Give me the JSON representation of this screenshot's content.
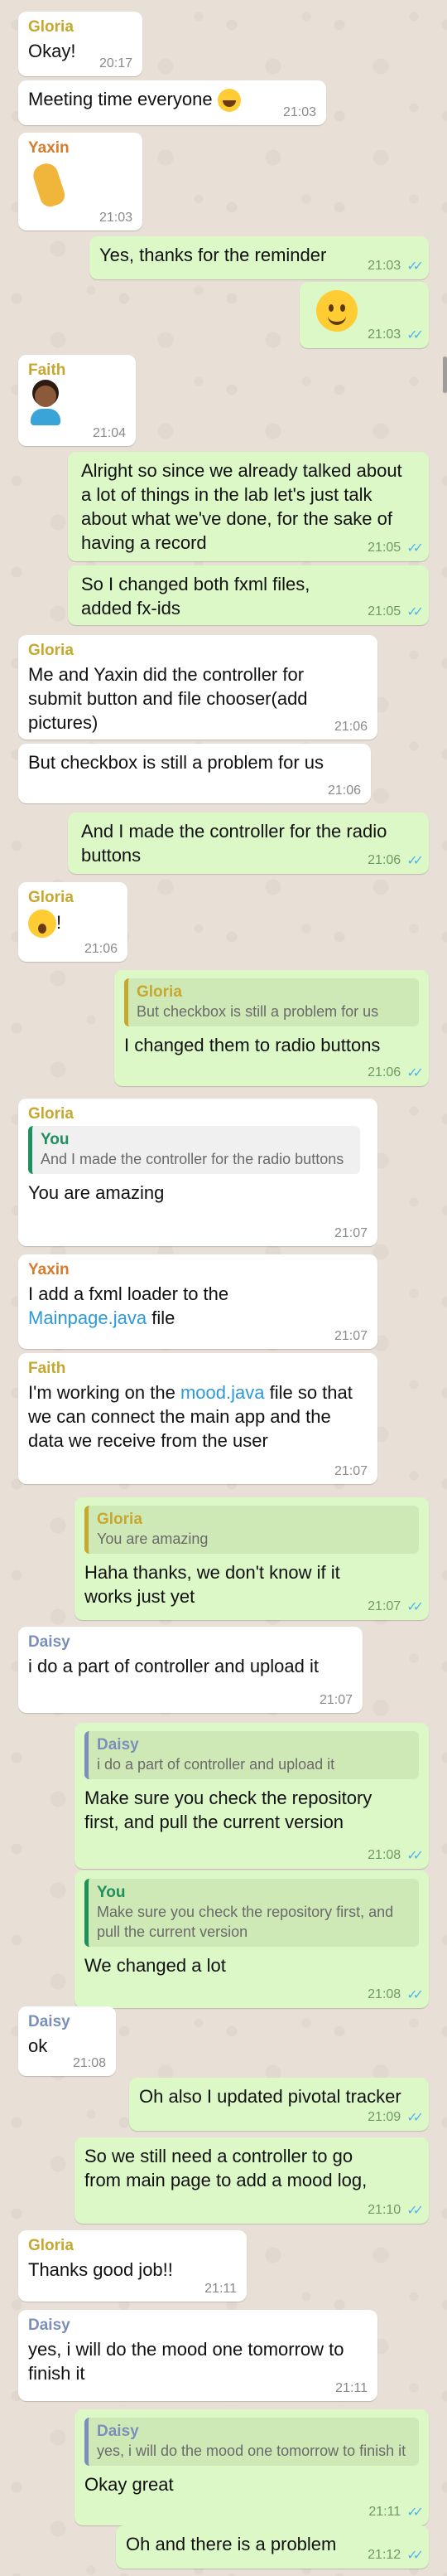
{
  "colors": {
    "gloria": "#c6a830",
    "yaxin": "#d77b2c",
    "faith": "#c6a830",
    "daisy": "#7b8fbb",
    "you": "#1f8f5b",
    "outgoing_bg": "#dcf8c6",
    "incoming_bg": "#ffffff",
    "read_ticks": "#4fb6ec"
  },
  "messages": [
    {
      "sender": "Gloria",
      "text": "Okay!",
      "time": "20:17"
    },
    {
      "text": "Meeting time everyone",
      "emoji": "face-with-tears-of-joy",
      "time": "21:03"
    },
    {
      "sender": "Yaxin",
      "emoji": "ok-hand",
      "time": "21:03"
    },
    {
      "text": "Yes, thanks for the reminder",
      "time": "21:03"
    },
    {
      "emoji": "smiling-face",
      "time": "21:03"
    },
    {
      "sender": "Faith",
      "emoji": "person-raising-hand",
      "time": "21:04"
    },
    {
      "text": "Alright so since we already talked about a lot of things in the lab let's just talk about what we've done, for the sake of having a record",
      "time": "21:05"
    },
    {
      "text": "So I changed both fxml files, added fx-ids",
      "time": "21:05"
    },
    {
      "sender": "Gloria",
      "text": "Me and Yaxin did the controller for submit button and file chooser(add pictures)",
      "time": "21:06"
    },
    {
      "text": "But checkbox is still a problem for us",
      "time": "21:06"
    },
    {
      "text": "And I made the controller for the radio buttons",
      "time": "21:06"
    },
    {
      "sender": "Gloria",
      "text": "!",
      "emoji": "astonished-face",
      "time": "21:06"
    },
    {
      "quote_name": "Gloria",
      "quote_text": "But checkbox is still a problem for us",
      "text": "I changed them to radio buttons",
      "time": "21:06"
    },
    {
      "sender": "Gloria",
      "quote_name": "You",
      "quote_text": "And I made the controller for the radio buttons",
      "text": "You are amazing",
      "time": "21:07"
    },
    {
      "sender": "Yaxin",
      "text": "I add a fxml loader to the",
      "link": "Mainpage.java",
      "text_after": " file",
      "time": "21:07"
    },
    {
      "sender": "Faith",
      "text": "I'm working on the ",
      "link": "mood.java",
      "text_after": " file so that we can connect the main app and the data we receive from the user",
      "time": "21:07"
    },
    {
      "quote_name": "Gloria",
      "quote_text": "You are amazing",
      "text": "Haha thanks, we don't know if it works just yet",
      "time": "21:07"
    },
    {
      "sender": "Daisy",
      "text": "i do a part of controller and upload it",
      "time": "21:07"
    },
    {
      "quote_name": "Daisy",
      "quote_text": "i do a part of controller and upload it",
      "text": "Make sure you check the repository first, and pull the current version",
      "time": "21:08"
    },
    {
      "quote_name": "You",
      "quote_text": "Make sure you check the repository first, and pull the current version",
      "text": "We changed a lot",
      "time": "21:08"
    },
    {
      "sender": "Daisy",
      "text": "ok",
      "time": "21:08"
    },
    {
      "text": "Oh also I updated pivotal tracker",
      "time": "21:09"
    },
    {
      "text": "So we still need a controller to go from main page to add a mood log,",
      "time": "21:10"
    },
    {
      "sender": "Gloria",
      "text": "Thanks good job!!",
      "time": "21:11"
    },
    {
      "sender": "Daisy",
      "text": "yes, i will do the mood one tomorrow to finish it",
      "time": "21:11"
    },
    {
      "quote_name": "Daisy",
      "quote_text": "yes, i will do the mood one tomorrow to finish it",
      "text": "Okay great",
      "time": "21:11"
    },
    {
      "text": "Oh and there is a problem",
      "time": "21:12"
    }
  ]
}
